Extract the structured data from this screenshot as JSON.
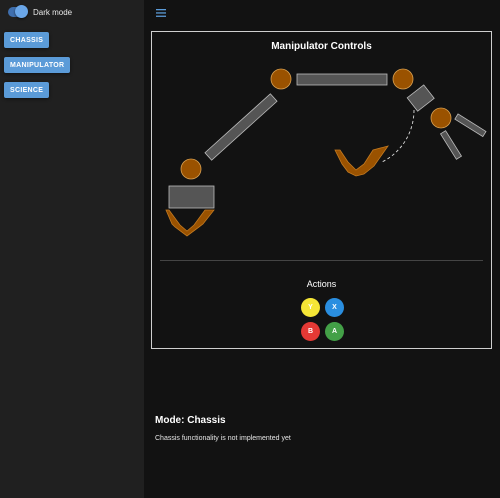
{
  "sidebar": {
    "dark_mode_label": "Dark mode",
    "dark_mode_on": true,
    "nav": [
      {
        "label": "CHASSIS"
      },
      {
        "label": "MANIPULATOR"
      },
      {
        "label": "SCIENCE"
      }
    ]
  },
  "header": {
    "menu_icon": "hamburger-menu-icon"
  },
  "panel": {
    "title": "Manipulator Controls",
    "actions_label": "Actions",
    "buttons": [
      {
        "label": "Y",
        "color": "#f5e636"
      },
      {
        "label": "X",
        "color": "#2a8ee0"
      },
      {
        "label": "B",
        "color": "#e53935"
      },
      {
        "label": "A",
        "color": "#43a047"
      }
    ]
  },
  "mode": {
    "title": "Mode: Chassis",
    "description": "Chassis functionality is not implemented yet"
  },
  "colors": {
    "joint": "#9a5200",
    "segment": "#555555",
    "accent": "#5b9bd8"
  }
}
